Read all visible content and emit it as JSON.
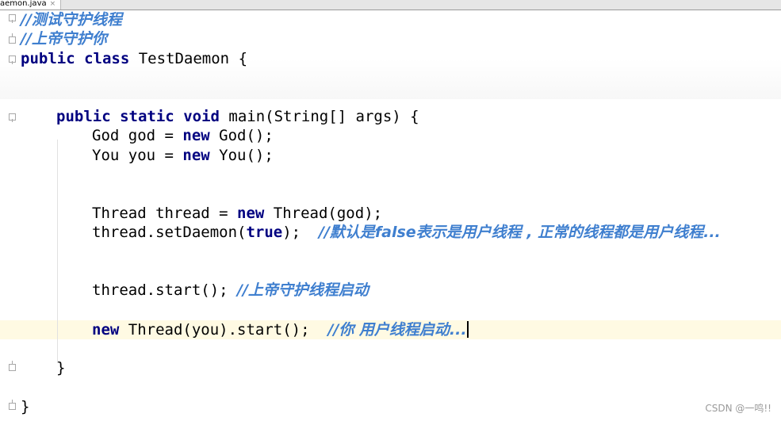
{
  "tab": {
    "filename": "aemon.java",
    "close_glyph": "×"
  },
  "code": {
    "l1_comment": "//测试守护线程",
    "l2_comment": "//上帝守护你",
    "l3_kw1": "public",
    "l3_kw2": "class",
    "l3_rest": " TestDaemon {",
    "l4_kw1": "public",
    "l4_kw2": "static",
    "l4_kw3": "void",
    "l4_rest": " main(String[] args) {",
    "l5_a": "God god = ",
    "l5_kw": "new",
    "l5_b": " God();",
    "l6_a": "You you = ",
    "l6_kw": "new",
    "l6_b": " You();",
    "l7_a": "Thread thread = ",
    "l7_kw": "new",
    "l7_b": " Thread(god);",
    "l8_a": "thread.setDaemon(",
    "l8_kw": "true",
    "l8_b": ");  ",
    "l8_comment": "//默认是false表示是用户线程 , 正常的线程都是用户线程...",
    "l9_a": "thread.start(); ",
    "l9_comment": "//上帝守护线程启动",
    "l10_kw": "new",
    "l10_b": " Thread(you).start();  ",
    "l10_comment": "//你 用户线程启动...",
    "l11": "}",
    "l12": "}"
  },
  "watermark": "CSDN @一鸣!!"
}
